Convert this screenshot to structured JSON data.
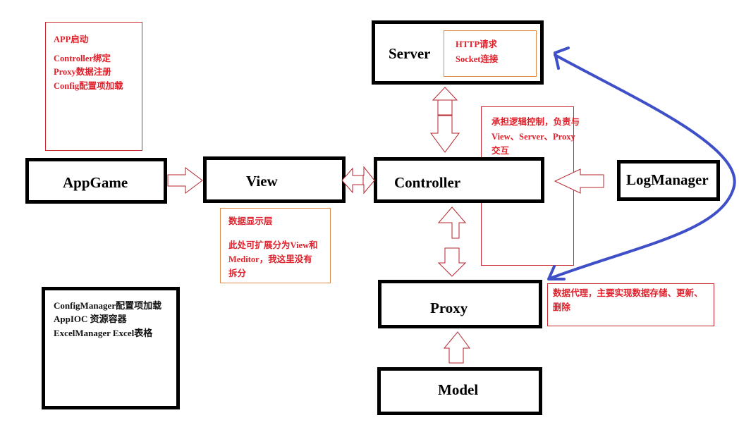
{
  "nodes": {
    "appgame": "AppGame",
    "view": "View",
    "controller": "Controller",
    "server": "Server",
    "logmanager": "LogManager",
    "proxy": "Proxy",
    "model": "Model"
  },
  "notes": {
    "app_startup": [
      "APP启动",
      "Controller绑定",
      "Proxy数据注册",
      "Config配置项加载"
    ],
    "server": [
      "HTTP请求",
      "Socket连接"
    ],
    "controller": [
      "承担逻辑控制，负责与",
      "View、Server、Proxy",
      "交互"
    ],
    "view": [
      "数据显示层",
      "此处可扩展分为View和",
      "Meditor，我这里没有",
      "拆分"
    ],
    "proxy": [
      "数据代理，主要实现数据存储、更新、",
      "删除"
    ],
    "managers": [
      "ConfigManager配置项加载",
      "AppIOC  资源容器",
      "ExcelManager  Excel表格"
    ]
  },
  "colors": {
    "box_border": "#000000",
    "note_border": "#c8282e",
    "note_border_orange": "#e08a4a",
    "note_text": "#e0202a",
    "arrow_outline": "#b5252d",
    "curve": "#3f4fc8"
  }
}
